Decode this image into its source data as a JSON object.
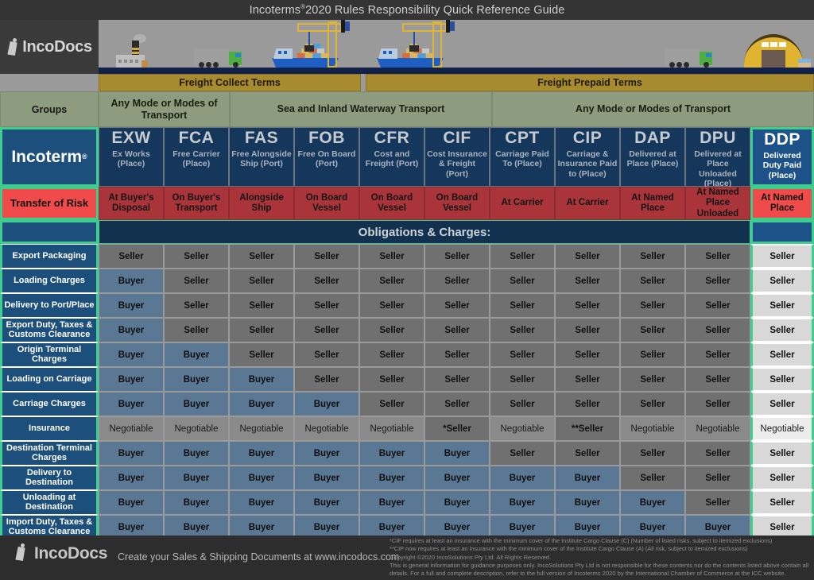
{
  "title": {
    "text_before": "Incoterms",
    "reg": "®",
    "text_after": "2020 Rules Responsibility Quick Reference Guide"
  },
  "brand": {
    "name": "IncoDocs",
    "logo_icon": "incodocs-logo-icon"
  },
  "banner": {
    "icons": [
      "factory-icon",
      "truck-icon",
      "container-ship-icon",
      "port-crane-icon",
      "warehouse-icon"
    ]
  },
  "bands": {
    "freight_collect": "Freight Collect Terms",
    "freight_prepaid": "Freight Prepaid Terms"
  },
  "modes": {
    "groups_label": "Groups",
    "any_mode_left": "Any Mode or Modes of Transport",
    "sea_inland": "Sea and Inland Waterway Transport",
    "any_mode_right": "Any Mode or Modes of Transport"
  },
  "side": {
    "incoterm": "Incoterm",
    "incoterm_reg": "®",
    "transfer_of_risk": "Transfer of Risk",
    "obligations_banner": "Obligations & Charges:"
  },
  "terms": [
    {
      "abbr": "EXW",
      "full": "Ex Works (Place)",
      "risk": "At Buyer's Disposal"
    },
    {
      "abbr": "FCA",
      "full": "Free Carrier (Place)",
      "risk": "On Buyer's Transport"
    },
    {
      "abbr": "FAS",
      "full": "Free Alongside Ship (Port)",
      "risk": "Alongside Ship"
    },
    {
      "abbr": "FOB",
      "full": "Free On Board (Port)",
      "risk": "On Board Vessel"
    },
    {
      "abbr": "CFR",
      "full": "Cost and Freight (Port)",
      "risk": "On Board Vessel"
    },
    {
      "abbr": "CIF",
      "full": "Cost Insurance & Freight (Port)",
      "risk": "On Board Vessel"
    },
    {
      "abbr": "CPT",
      "full": "Carriage Paid To (Place)",
      "risk": "At Carrier"
    },
    {
      "abbr": "CIP",
      "full": "Carriage & Insurance Paid to (Place)",
      "risk": "At Carrier"
    },
    {
      "abbr": "DAP",
      "full": "Delivered at Place (Place)",
      "risk": "At Named Place"
    },
    {
      "abbr": "DPU",
      "full": "Delivered at Place Unloaded (Place)",
      "risk": "At Named Place Unloaded"
    },
    {
      "abbr": "DDP",
      "full": "Delivered Duty Paid (Place)",
      "risk": "At Named Place"
    }
  ],
  "chart_data": {
    "type": "table",
    "title": "Incoterms®2020 Rules Responsibility Quick Reference Guide",
    "columns": [
      "EXW",
      "FCA",
      "FAS",
      "FOB",
      "CFR",
      "CIF",
      "CPT",
      "CIP",
      "DAP",
      "DPU",
      "DDP"
    ],
    "row_labels": [
      "Export Packaging",
      "Loading Charges",
      "Delivery to Port/Place",
      "Export Duty, Taxes & Customs Clearance",
      "Origin Terminal Charges",
      "Loading on Carriage",
      "Carriage Charges",
      "Insurance",
      "Destination Terminal Charges",
      "Delivery to Destination",
      "Unloading at Destination",
      "Import Duty, Taxes & Customs Clearance"
    ],
    "values": [
      [
        "Seller",
        "Seller",
        "Seller",
        "Seller",
        "Seller",
        "Seller",
        "Seller",
        "Seller",
        "Seller",
        "Seller",
        "Seller"
      ],
      [
        "Buyer",
        "Seller",
        "Seller",
        "Seller",
        "Seller",
        "Seller",
        "Seller",
        "Seller",
        "Seller",
        "Seller",
        "Seller"
      ],
      [
        "Buyer",
        "Seller",
        "Seller",
        "Seller",
        "Seller",
        "Seller",
        "Seller",
        "Seller",
        "Seller",
        "Seller",
        "Seller"
      ],
      [
        "Buyer",
        "Seller",
        "Seller",
        "Seller",
        "Seller",
        "Seller",
        "Seller",
        "Seller",
        "Seller",
        "Seller",
        "Seller"
      ],
      [
        "Buyer",
        "Buyer",
        "Seller",
        "Seller",
        "Seller",
        "Seller",
        "Seller",
        "Seller",
        "Seller",
        "Seller",
        "Seller"
      ],
      [
        "Buyer",
        "Buyer",
        "Buyer",
        "Seller",
        "Seller",
        "Seller",
        "Seller",
        "Seller",
        "Seller",
        "Seller",
        "Seller"
      ],
      [
        "Buyer",
        "Buyer",
        "Buyer",
        "Buyer",
        "Seller",
        "Seller",
        "Seller",
        "Seller",
        "Seller",
        "Seller",
        "Seller"
      ],
      [
        "Negotiable",
        "Negotiable",
        "Negotiable",
        "Negotiable",
        "Negotiable",
        "*Seller",
        "Negotiable",
        "**Seller",
        "Negotiable",
        "Negotiable",
        "Negotiable"
      ],
      [
        "Buyer",
        "Buyer",
        "Buyer",
        "Buyer",
        "Buyer",
        "Buyer",
        "Seller",
        "Seller",
        "Seller",
        "Seller",
        "Seller"
      ],
      [
        "Buyer",
        "Buyer",
        "Buyer",
        "Buyer",
        "Buyer",
        "Buyer",
        "Buyer",
        "Buyer",
        "Seller",
        "Seller",
        "Seller"
      ],
      [
        "Buyer",
        "Buyer",
        "Buyer",
        "Buyer",
        "Buyer",
        "Buyer",
        "Buyer",
        "Buyer",
        "Buyer",
        "Seller",
        "Seller"
      ],
      [
        "Buyer",
        "Buyer",
        "Buyer",
        "Buyer",
        "Buyer",
        "Buyer",
        "Buyer",
        "Buyer",
        "Buyer",
        "Buyer",
        "Seller"
      ]
    ],
    "legend": {
      "seller_color": "#707070",
      "buyer_color": "#5a7894",
      "negotiable_color": "#8a8a8a",
      "highlight_color": "#3ecf8e",
      "risk_color": "#a93439"
    }
  },
  "footer": {
    "brand": "IncoDocs",
    "tagline": "Create your Sales & Shipping Documents at www.incodocs.com",
    "notes": [
      "*CIF requires at least an insurance with the minimum cover of the Institute Cargo Clause (C) (Number of listed risks, subject to itemized exclusions)",
      "**CIP now requires at least an insurance with the minimum cover of the Institute Cargo Clause (A) (All risk, subject to itemized exclusions)",
      "Copyright ©2020 IncoSolutions Pty Ltd. All Rights Reserved.",
      "This is general information for guidance purposes only.  IncoSolutions Pty Ltd is not responsible for these contents nor do the contents listed above contain all",
      "details.  For a full and complete description, refer to the full version of Incoterms   2020 by the International Chamber of Commerce at the ICC website."
    ]
  }
}
